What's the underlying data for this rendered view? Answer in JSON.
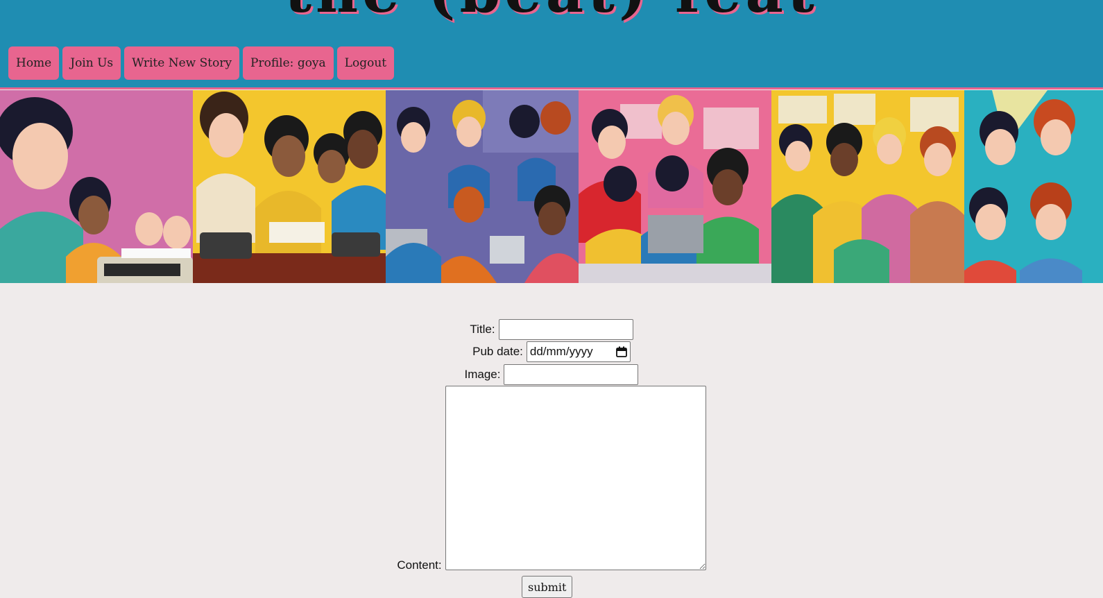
{
  "site": {
    "title": "the (beat) feat"
  },
  "nav": {
    "items": [
      {
        "label": "Home",
        "name": "nav-home-button"
      },
      {
        "label": "Join Us",
        "name": "nav-join-us-button"
      },
      {
        "label": "Write New Story",
        "name": "nav-write-new-story-button"
      },
      {
        "label": "Profile: goya",
        "name": "nav-profile-button"
      },
      {
        "label": "Logout",
        "name": "nav-logout-button"
      }
    ]
  },
  "colors": {
    "header_bg": "#1f8db2",
    "nav_button_bg": "#e8658f",
    "page_bg": "#efebeb"
  },
  "form": {
    "title_label": "Title:",
    "title_value": "",
    "pubdate_label": "Pub date:",
    "pubdate_placeholder": "dd/mm/yyyy",
    "image_label": "Image:",
    "image_value": "",
    "content_label": "Content:",
    "content_value": "",
    "submit_label": "submit"
  }
}
